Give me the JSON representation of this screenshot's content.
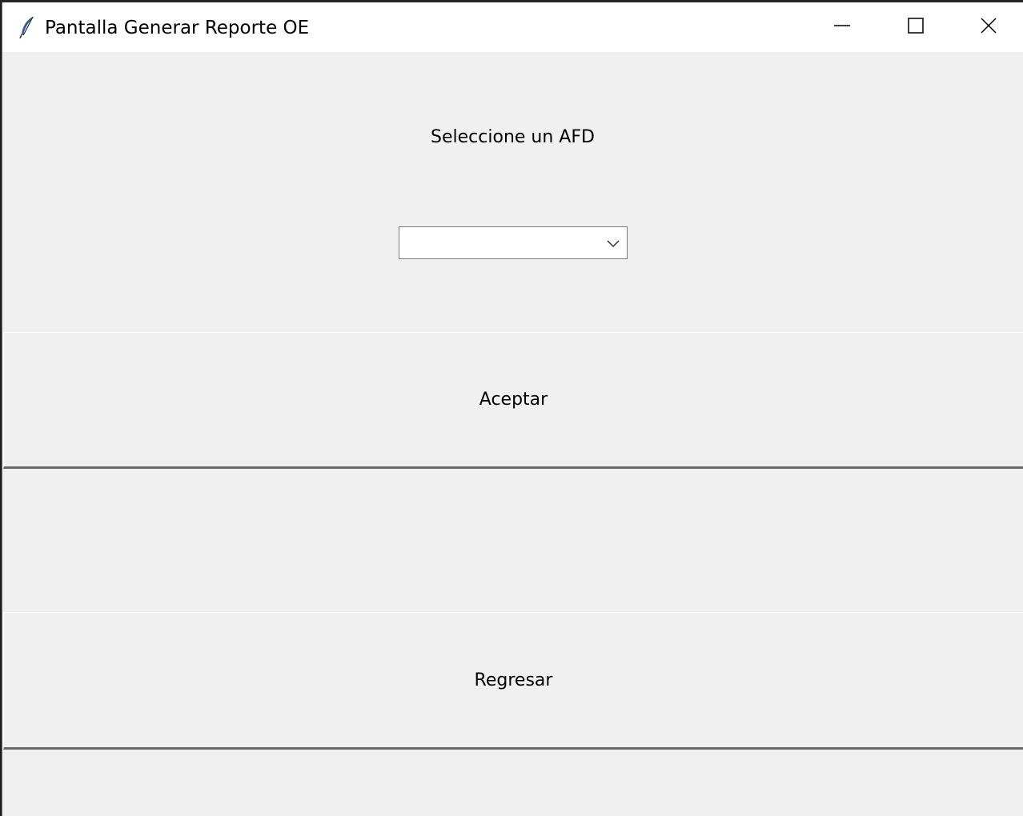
{
  "window": {
    "title": "Pantalla Generar Reporte OE",
    "icon": "feather-icon"
  },
  "controls": {
    "minimize": "minimize-icon",
    "maximize": "maximize-icon",
    "close": "close-icon"
  },
  "form": {
    "prompt": "Seleccione un AFD",
    "combo_value": "",
    "accept_label": "Aceptar",
    "back_label": "Regresar"
  }
}
